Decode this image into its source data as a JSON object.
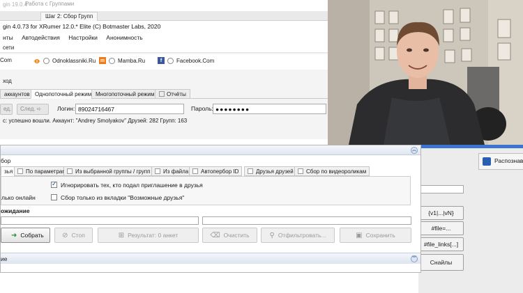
{
  "bg_window": {
    "title_fragment": "gin 19.0.4",
    "title_main": "Работа с Группами",
    "step_tab": "Шаг 2: Сбор Групп",
    "version_line": "gin 4.0.73 for XRumer 12.0.* Elite (C) Botmaster Labs, 2020",
    "menu": [
      "нты",
      "Автодействия",
      "Настройки",
      "Анонимность"
    ],
    "section_label": "сети",
    "social": [
      {
        "label": "Com",
        "icon": "globe-icon"
      },
      {
        "label": "Odnoklassniki.Ru",
        "icon": "odnoklassniki-icon",
        "color": "#f2891c"
      },
      {
        "label": "Mamba.Ru",
        "icon": "mamba-icon",
        "color": "#f07a18"
      },
      {
        "label": "Facebook.Com",
        "icon": "facebook-icon",
        "color": "#3b5998"
      }
    ],
    "enter_label": "ход",
    "mode_tabs": [
      "аккаунтов",
      "Однопоточный режим",
      "Многопоточный режим",
      "Отчёты"
    ],
    "prev_btn": "ед.",
    "next_btn": "След.",
    "login_label": "Логин:",
    "login_value": "89024716467",
    "password_label": "Пароль:",
    "password_value": "●●●●●●●●",
    "status": "с: успешно вошли. Аккаунт: \"Andrey Smolyakov\" Друзей: 282 Групп: 163"
  },
  "dialog": {
    "label": "бор",
    "tabs": [
      "зья",
      "По параметрам",
      "Из выбранной группы / групп",
      "Из файла",
      "Автопербор ID",
      "Друзья друзей",
      "Сбор по видеороликам"
    ],
    "opt_ignore": "Игнорировать тех, кто подал приглашение в друзья",
    "opt_left": "лько онлайн",
    "opt_possible": "Сбор только из вкладки \"Возможные друзья\"",
    "wait_label": "ожидание",
    "btn_collect": "Собрать",
    "btn_stop": "Стоп",
    "btn_result": "Результат: 0 анкет",
    "btn_clear": "Очистить",
    "btn_filter": "Отфильтровать...",
    "btn_save": "Сохранить",
    "footer": "ие"
  },
  "right_panel": {
    "raspoz": "Распознава",
    "btn_v1": "{v1|...|vN}",
    "btn_file": "#file=...",
    "btn_file_links": "#file_links[...]",
    "btn_snails": "Снайлы"
  },
  "colors": {
    "accent_blue": "#3c74d2",
    "panel_bg": "#f4f4f4"
  }
}
